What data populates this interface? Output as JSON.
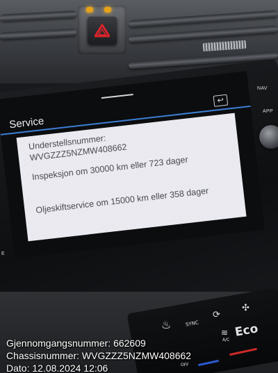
{
  "screen": {
    "title": "Service",
    "lines": [
      "Understellsnummer:",
      "WVGZZZ5NZMW408662",
      "Inspeksjon om 30000 km eller 723 dager",
      "Oljeskiftservice om 15000 km eller 358 dager"
    ]
  },
  "unit_buttons": {
    "nav": "NAV",
    "app": "APP",
    "left_edge": "E"
  },
  "console": {
    "sync": "SYNC",
    "ac": "A/C",
    "eco": "Eco",
    "off": "OFF"
  },
  "caption": {
    "line1": "Gjennomgangsnummer: 662609",
    "line2": "Chassisnummer: WVGZZZ5NZMW408662",
    "line3": "Dato: 12.08.2024 12:06"
  },
  "colors": {
    "accent_blue": "#3d7fd6",
    "hazard_red": "#d8232a"
  },
  "icons": [
    "hazard-icon",
    "back-icon",
    "seat-heat-icon",
    "fan-icon",
    "recirculation-icon",
    "rear-defrost-icon"
  ]
}
